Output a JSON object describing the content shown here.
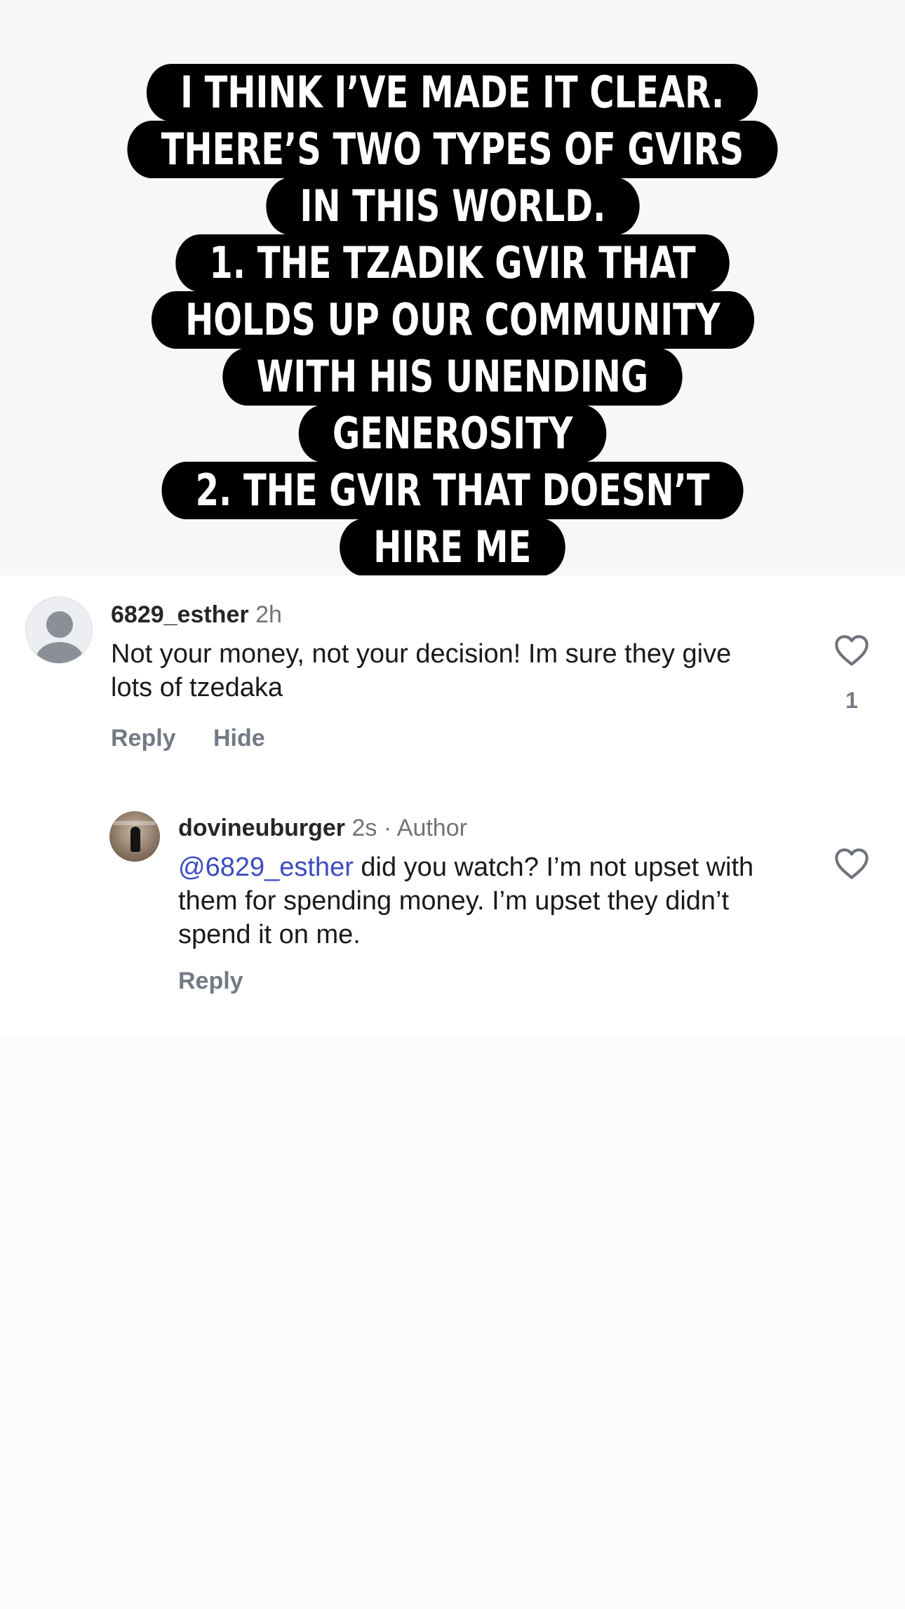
{
  "story_caption": {
    "lines": [
      "I THINK I’VE MADE IT CLEAR.",
      "THERE’S TWO TYPES OF GVIRS",
      "IN THIS WORLD.",
      "1. THE TZADIK GVIR THAT",
      "HOLDS UP OUR COMMUNITY",
      "WITH HIS UNENDING",
      "GENEROSITY",
      "2. THE GVIR THAT DOESN’T",
      "HIRE ME"
    ]
  },
  "comments": [
    {
      "username": "6829_esther",
      "time": "2h",
      "text": "Not your money, not your decision! Im sure they give lots of tzedaka",
      "like_count": "1",
      "actions": {
        "reply": "Reply",
        "hide": "Hide"
      },
      "avatar_icon": "default-user-avatar-icon"
    },
    {
      "username": "dovineuburger",
      "time": "2s",
      "separator": "·",
      "author_badge": "Author",
      "mention": "@6829_esther",
      "text": " did you watch? I’m not upset with them for spending money. I’m upset they didn’t spend it on me.",
      "actions": {
        "reply": "Reply"
      },
      "avatar_icon": "profile-photo-avatar"
    }
  ],
  "colors": {
    "caption_bg": "#000000",
    "caption_text": "#ffffff",
    "mention": "#3b4cc0",
    "muted": "#737373"
  }
}
